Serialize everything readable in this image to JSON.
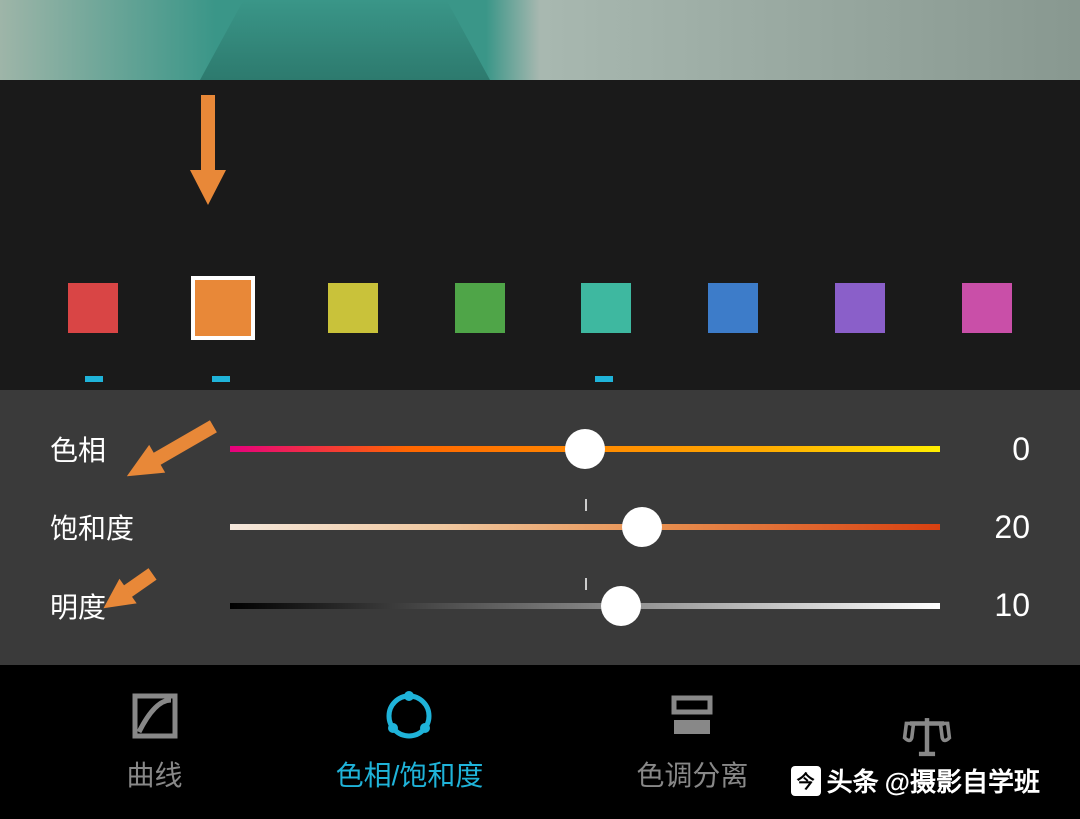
{
  "colors": {
    "swatches": [
      "#d94545",
      "#e88838",
      "#c9c23a",
      "#4fa548",
      "#3eb8a0",
      "#3d7cc9",
      "#8a5fc9",
      "#c94fa8"
    ],
    "selected_index": 1,
    "ticked_indices": [
      0,
      1,
      4
    ]
  },
  "sliders": {
    "hue": {
      "label": "色相",
      "value": "0",
      "percent": 50
    },
    "sat": {
      "label": "饱和度",
      "value": "20",
      "percent": 58
    },
    "light": {
      "label": "明度",
      "value": "10",
      "percent": 55
    }
  },
  "nav": {
    "items": [
      {
        "label": "曲线",
        "icon": "curves"
      },
      {
        "label": "色相/饱和度",
        "icon": "hsl"
      },
      {
        "label": "色调分离",
        "icon": "split"
      },
      {
        "label": "",
        "icon": "balance"
      }
    ],
    "active_index": 1
  },
  "watermark": {
    "prefix": "头条",
    "text": "@摄影自学班"
  }
}
